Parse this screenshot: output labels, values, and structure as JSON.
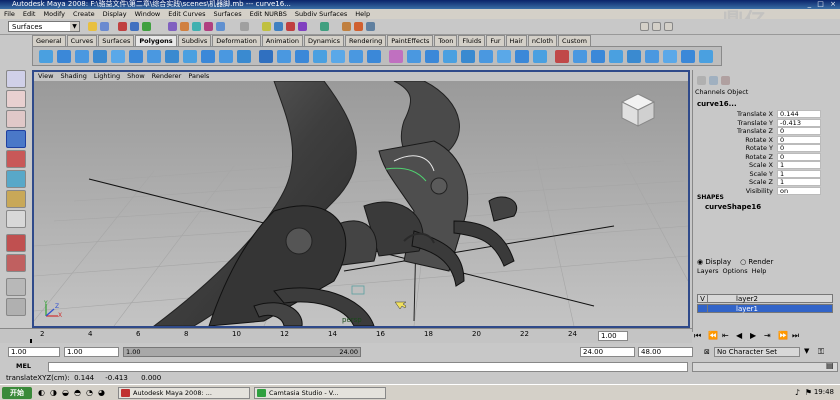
{
  "window": {
    "title": "Autodesk Maya 2008: F:\\骆益文件\\第二章\\综合实践\\scenes\\机器脚.mb  ---  curve16...",
    "controls": "_ □ ×"
  },
  "menubar": [
    "File",
    "Edit",
    "Modify",
    "Create",
    "Display",
    "Window",
    "Edit Curves",
    "Surfaces",
    "Edit NURBS",
    "Subdiv Surfaces",
    "Help"
  ],
  "status_line": {
    "menu_set": "Surfaces"
  },
  "shelf_tabs": [
    {
      "label": "General"
    },
    {
      "label": "Curves"
    },
    {
      "label": "Surfaces"
    },
    {
      "label": "Polygons",
      "active": true
    },
    {
      "label": "Subdivs"
    },
    {
      "label": "Deformation"
    },
    {
      "label": "Animation"
    },
    {
      "label": "Dynamics"
    },
    {
      "label": "Rendering"
    },
    {
      "label": "PaintEffects"
    },
    {
      "label": "Toon"
    },
    {
      "label": "Fluids"
    },
    {
      "label": "Fur"
    },
    {
      "label": "Hair"
    },
    {
      "label": "nCloth"
    },
    {
      "label": "Custom"
    }
  ],
  "viewport": {
    "menu": [
      "View",
      "Shading",
      "Lighting",
      "Show",
      "Renderer",
      "Panels"
    ],
    "camera_label": "persp",
    "axis_labels": {
      "x": "X",
      "y": "Y",
      "z": "Z"
    }
  },
  "channel_box": {
    "header": [
      "Channels",
      "Object"
    ],
    "object": "curve16...",
    "attributes": [
      {
        "name": "Translate X",
        "value": "0.144"
      },
      {
        "name": "Translate Y",
        "value": "-0.413"
      },
      {
        "name": "Translate Z",
        "value": "0"
      },
      {
        "name": "Rotate X",
        "value": "0"
      },
      {
        "name": "Rotate Y",
        "value": "0"
      },
      {
        "name": "Rotate Z",
        "value": "0"
      },
      {
        "name": "Scale X",
        "value": "1"
      },
      {
        "name": "Scale Y",
        "value": "1"
      },
      {
        "name": "Scale Z",
        "value": "1"
      },
      {
        "name": "Visibility",
        "value": "on"
      }
    ],
    "shapes_label": "SHAPES",
    "shape_name": "curveShape16"
  },
  "layers": {
    "display_label": "Display",
    "render_label": "Render",
    "menu": [
      "Layers",
      "Options",
      "Help"
    ],
    "items": [
      {
        "vis": "V",
        "name": "layer2",
        "selected": false
      },
      {
        "vis": "",
        "name": "layer1",
        "selected": true
      }
    ]
  },
  "time_slider": {
    "ticks": [
      "2",
      "4",
      "6",
      "8",
      "10",
      "12",
      "14",
      "16",
      "18",
      "20",
      "22",
      "24"
    ],
    "current_frame": "1.00"
  },
  "range": {
    "start": "1.00",
    "playback_start": "1.00",
    "slider_left": "1.00",
    "slider_right": "24.00",
    "playback_end": "24.00",
    "end": "48.00",
    "character_set": "No Character Set"
  },
  "command_line": {
    "label": "MEL"
  },
  "help_line": "translateXYZ(cm):  0.144     -0.413      0.000",
  "taskbar": {
    "start": "开始",
    "buttons": [
      {
        "label": "Autodesk Maya 2008: ..."
      },
      {
        "label": "Camtasia Studio - V..."
      }
    ],
    "clock": "19:48"
  },
  "watermark": "鼎亿..",
  "colors": {
    "viewport_border": "#2f4a8a",
    "selection": "#3264c8",
    "title": "#0a246a"
  }
}
